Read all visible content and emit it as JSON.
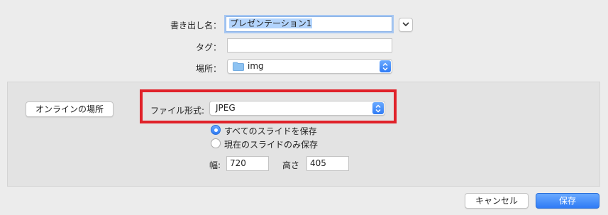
{
  "export": {
    "name_label": "書き出し名：",
    "name_value": "プレゼンテーション1",
    "tags_label": "タグ：",
    "tags_value": "",
    "location_label": "場所：",
    "location_value": "img"
  },
  "options": {
    "online_button": "オンラインの場所",
    "format_label": "ファイル形式:",
    "format_value": "JPEG",
    "radio_all": "すべてのスライドを保存",
    "radio_current": "現在のスライドのみ保存",
    "selected_radio": "all",
    "width_label": "幅:",
    "width_value": "720",
    "height_label": "高さ",
    "height_value": "405"
  },
  "footer": {
    "cancel": "キャンセル",
    "save": "保存"
  },
  "colors": {
    "accent": "#2f7bf5",
    "highlight_box": "#e0222a",
    "selection": "#b3d4fc"
  },
  "icons": {
    "expand": "chevron-down-icon",
    "folder": "folder-icon",
    "popup": "popup-arrows-icon"
  }
}
